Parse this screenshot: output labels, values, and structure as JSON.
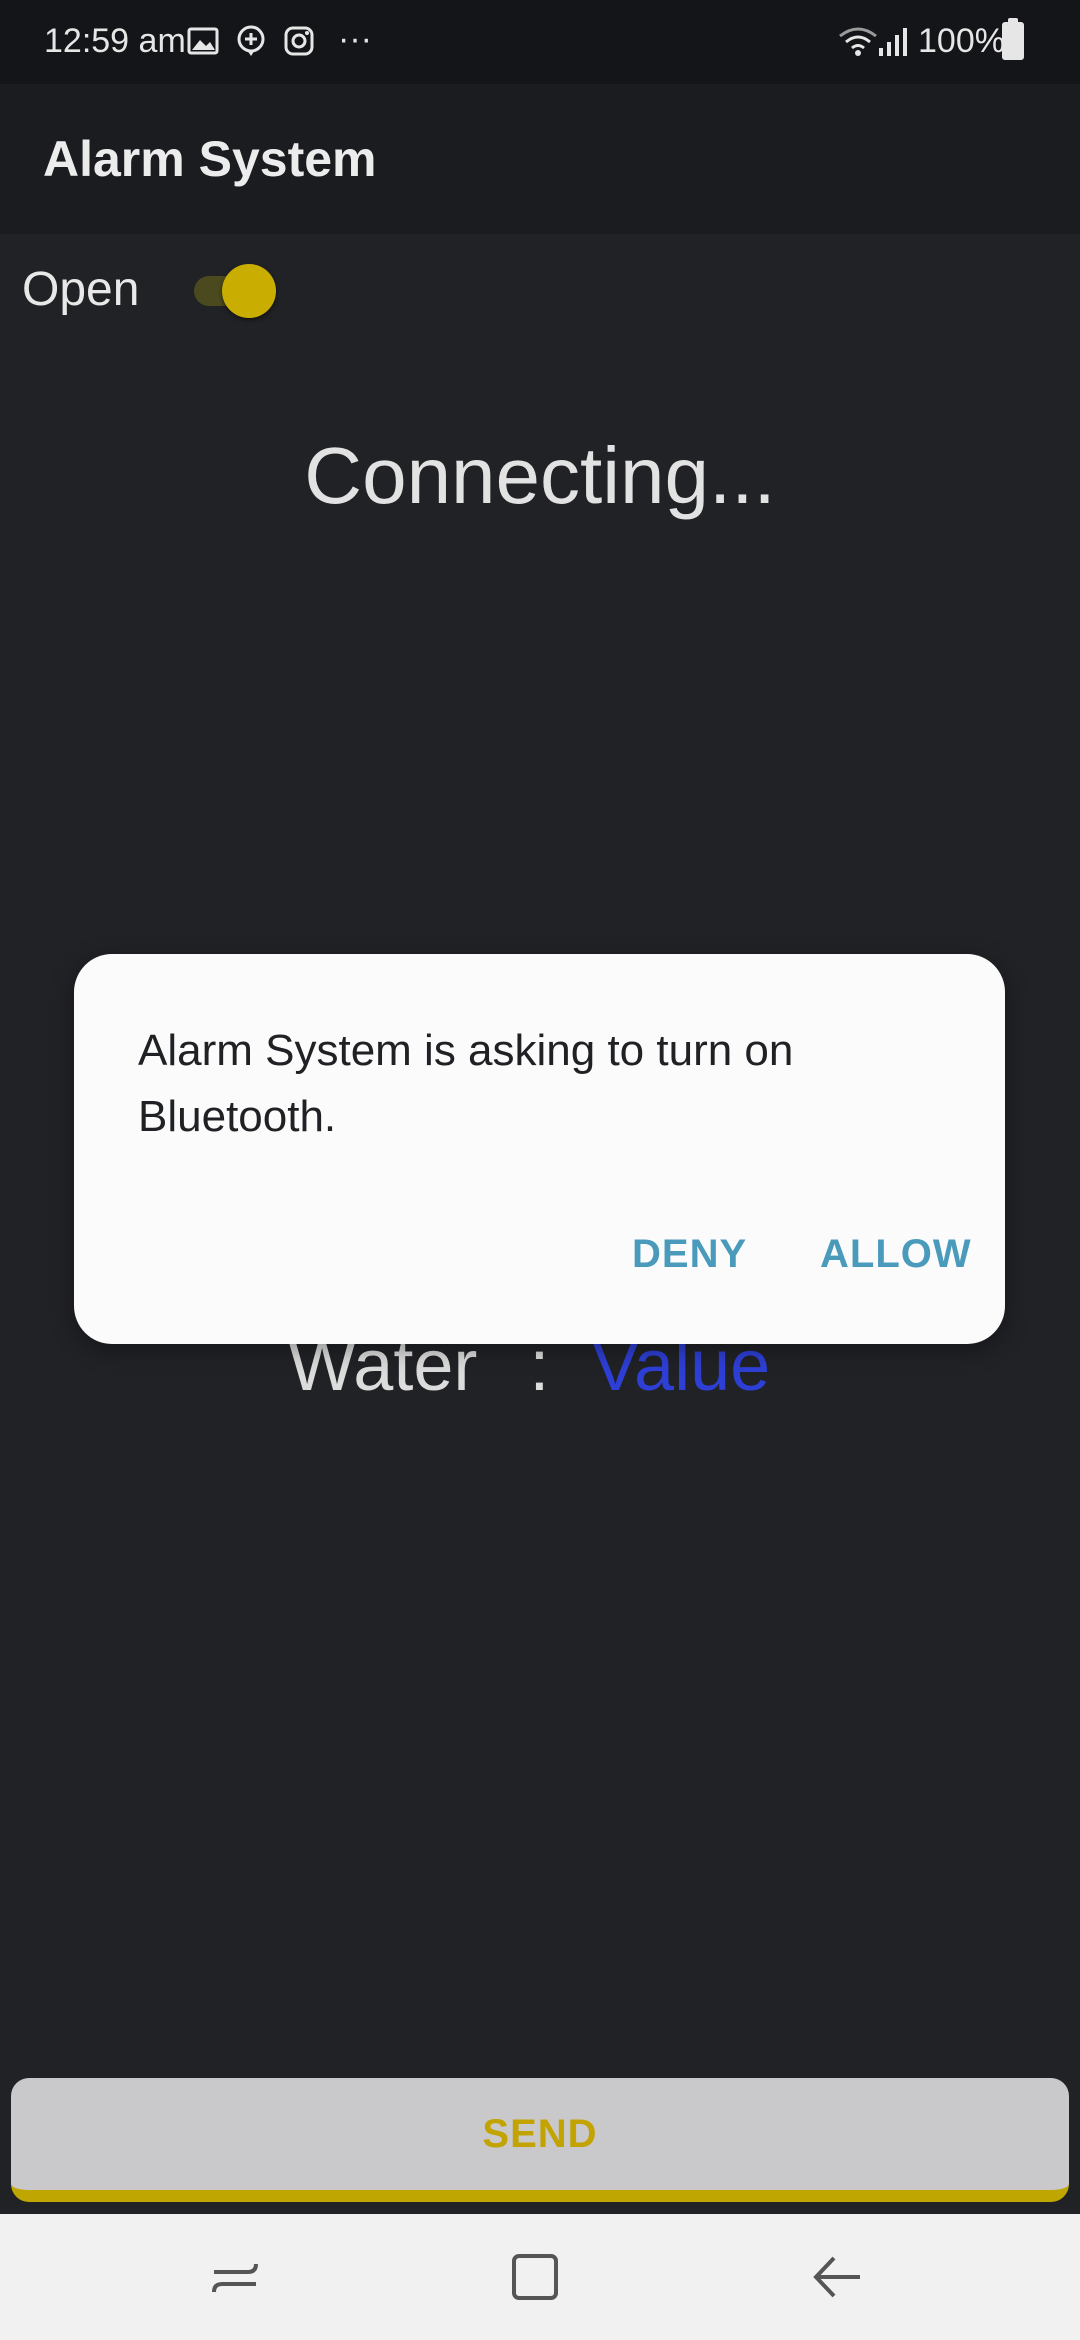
{
  "status_bar": {
    "time": "12:59 am",
    "battery": "100%",
    "more_indicator": "···"
  },
  "app_bar": {
    "title": "Alarm System"
  },
  "toggle": {
    "label": "Open",
    "state": "on"
  },
  "status_text": "Connecting...",
  "water": {
    "label": "Water",
    "separator": ":",
    "value": "Value"
  },
  "send_button": {
    "label": "SEND"
  },
  "dialog": {
    "message": "Alarm System is asking to turn on Bluetooth.",
    "deny_label": "DENY",
    "allow_label": "ALLOW"
  },
  "colors": {
    "background": "#212226",
    "accent": "#c9ad00",
    "dialog_button": "#4a9bbb",
    "value_text": "#2e3fd6"
  },
  "icons": {
    "status": [
      "image-icon",
      "location-plus-icon",
      "instagram-icon",
      "wifi-icon",
      "signal-icon",
      "battery-icon"
    ],
    "nav": [
      "recents-icon",
      "home-icon",
      "back-icon"
    ]
  }
}
